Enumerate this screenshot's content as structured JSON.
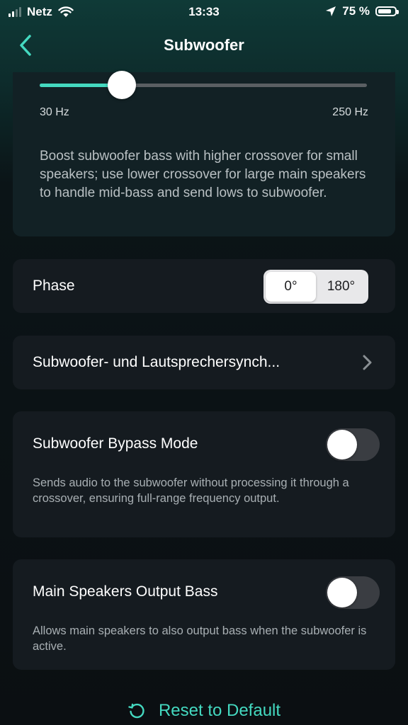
{
  "status_bar": {
    "carrier": "Netz",
    "time": "13:33",
    "battery": "75 %"
  },
  "header": {
    "title": "Subwoofer"
  },
  "crossover": {
    "min_label": "30 Hz",
    "max_label": "250 Hz",
    "level": 0.25,
    "description": "Boost subwoofer bass with higher crossover for small speakers; use lower crossover for large main speakers to handle mid-bass and send lows to subwoofer."
  },
  "phase": {
    "label": "Phase",
    "options": [
      "0°",
      "180°"
    ],
    "selected": "0°"
  },
  "sync": {
    "label": "Subwoofer- und Lautsprechersynch..."
  },
  "bypass": {
    "label": "Subwoofer Bypass Mode",
    "description": "Sends audio to the subwoofer without processing it through a crossover, ensuring full-range frequency output.",
    "enabled": false
  },
  "main_bass": {
    "label": "Main Speakers Output Bass",
    "description": "Allows main speakers to also output bass when the subwoofer is active.",
    "enabled": false
  },
  "reset": {
    "label": "Reset to Default"
  },
  "colors": {
    "accent": "#44d9c0"
  },
  "icons": {
    "back": "chevron-left-icon",
    "chevron": "chevron-right-icon",
    "reset": "reset-icon",
    "wifi": "wifi-icon",
    "location": "location-arrow-icon",
    "battery": "battery-icon"
  }
}
